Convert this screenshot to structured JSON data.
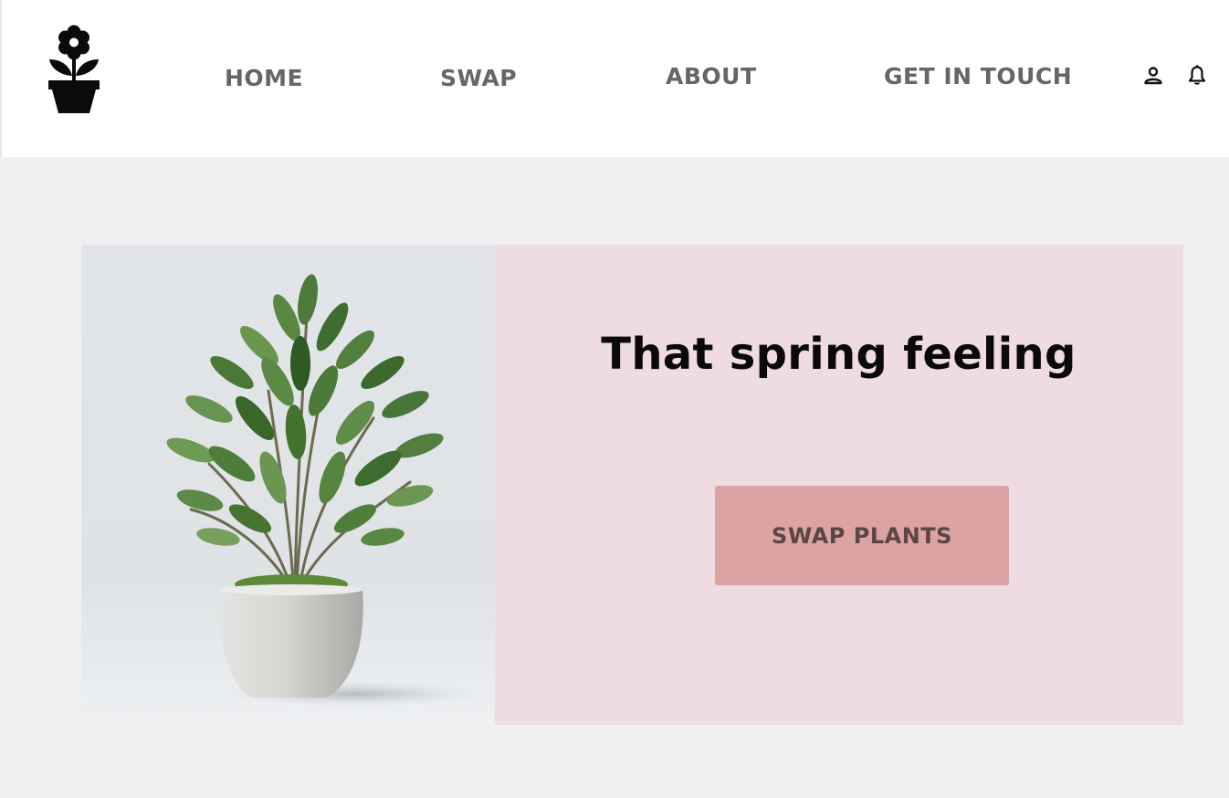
{
  "header": {
    "logo": "flower-pot-logo",
    "nav": {
      "home": "HOME",
      "swap": "SWAP",
      "about": "ABOUT",
      "contact": "GET IN TOUCH"
    },
    "icons": [
      "user-icon",
      "bell-icon"
    ]
  },
  "hero": {
    "image": "potted-plant-image",
    "title": "That spring feeling",
    "cta_label": "SWAP PLANTS"
  },
  "colors": {
    "page_bg": "#f0f0f0",
    "header_bg": "#ffffff",
    "hero_panel_bg": "#efdbe2",
    "cta_bg": "#dba3a2",
    "cta_text": "#5a4547",
    "nav_text": "#666666"
  }
}
